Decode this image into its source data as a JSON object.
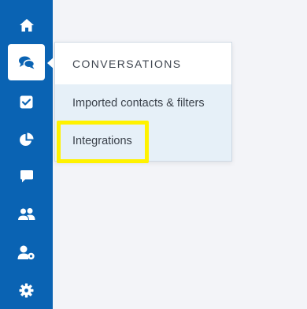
{
  "sidebar": {
    "background": "#0a63b3",
    "items": [
      {
        "icon": "home-icon",
        "active": false
      },
      {
        "icon": "conversations-icon",
        "active": true
      },
      {
        "icon": "checkbox-icon",
        "active": false
      },
      {
        "icon": "pie-chart-icon",
        "active": false
      },
      {
        "icon": "chat-icon",
        "active": false
      },
      {
        "icon": "users-icon",
        "active": false
      },
      {
        "icon": "user-settings-icon",
        "active": false
      },
      {
        "icon": "gear-icon",
        "active": false
      }
    ]
  },
  "submenu": {
    "title": "CONVERSATIONS",
    "items": [
      {
        "label": "Imported contacts & filters"
      },
      {
        "label": "Integrations"
      }
    ]
  },
  "highlight": {
    "color": "#fff200",
    "target": "Integrations"
  }
}
